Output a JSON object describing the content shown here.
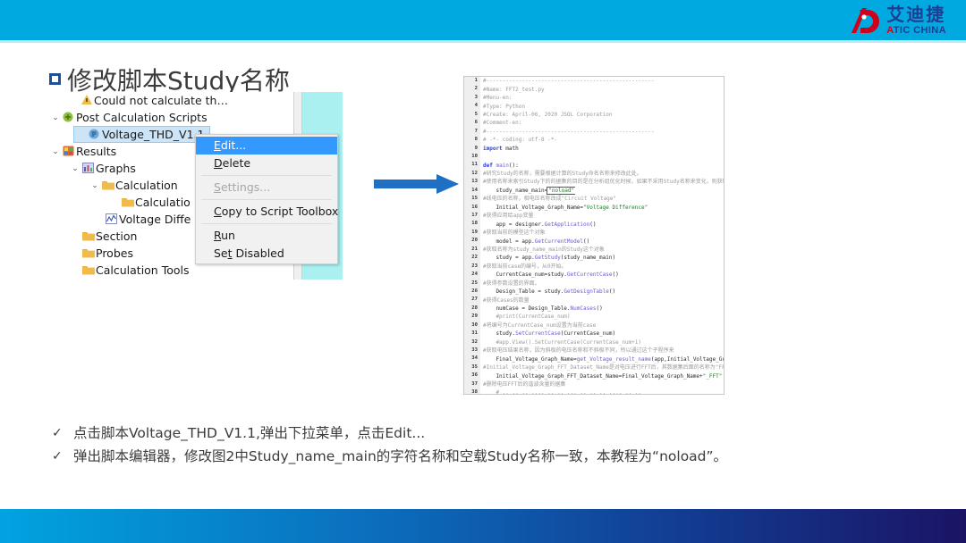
{
  "header": {
    "logo": {
      "mark": "ad-monogram-icon",
      "chinese": "艾迪捷",
      "english_a": "A",
      "english_rest": "TIC CHINA"
    },
    "bar_color": "#00a9e0"
  },
  "title": {
    "bullet": "square-bullet-icon",
    "text": "修改脚本Study名称"
  },
  "tree": {
    "rows": [
      {
        "indent": 28,
        "chevron": "",
        "icon": "warning-icon",
        "label": "Could not calculate th…",
        "selected": false
      },
      {
        "indent": 8,
        "chevron": "⌄",
        "icon": "script-folder-icon",
        "label": "Post Calculation Scripts",
        "selected": false
      },
      {
        "indent": 34,
        "chevron": "",
        "icon": "script-icon",
        "label": "Voltage_THD_V1.1",
        "selected": true
      },
      {
        "indent": 8,
        "chevron": "⌄",
        "icon": "results-icon",
        "label": "Results",
        "selected": false
      },
      {
        "indent": 30,
        "chevron": "⌄",
        "icon": "graphs-icon",
        "label": "Graphs",
        "selected": false
      },
      {
        "indent": 52,
        "chevron": "⌄",
        "icon": "folder-icon",
        "label": "Calculation",
        "selected": false
      },
      {
        "indent": 74,
        "chevron": "",
        "icon": "folder-icon",
        "label": "Calculatio",
        "selected": false
      },
      {
        "indent": 56,
        "chevron": "",
        "icon": "graph-curve-icon",
        "label": "Voltage Diffe",
        "selected": false
      },
      {
        "indent": 30,
        "chevron": "",
        "icon": "folder-icon",
        "label": "Section",
        "selected": false
      },
      {
        "indent": 30,
        "chevron": "",
        "icon": "folder-icon",
        "label": "Probes",
        "selected": false
      },
      {
        "indent": 30,
        "chevron": "",
        "icon": "folder-icon",
        "label": "Calculation Tools",
        "selected": false
      }
    ]
  },
  "context_menu": {
    "items": [
      {
        "label": "Edit...",
        "mnemonic": "E",
        "state": "selected"
      },
      {
        "label": "Delete",
        "mnemonic": "D",
        "state": "normal"
      },
      {
        "label": "Settings...",
        "mnemonic": "S",
        "state": "disabled"
      },
      {
        "label": "Copy to Script Toolbox",
        "mnemonic": "C",
        "state": "normal"
      },
      {
        "label": "Run",
        "mnemonic": "R",
        "state": "normal"
      },
      {
        "label": "Set Disabled",
        "mnemonic": "t",
        "state": "normal"
      }
    ]
  },
  "arrow": {
    "name": "right-arrow",
    "color": "#1f6fc4"
  },
  "code": {
    "highlight_value": "noload",
    "lines": [
      {
        "n": 1,
        "html": "<span class='cmt'>#----------------------------------------------------</span>"
      },
      {
        "n": 2,
        "html": "<span class='cmt'>#Name:&nbsp;FFT2_test.py</span>"
      },
      {
        "n": 3,
        "html": "<span class='cmt'>#Menu-en:&nbsp;</span>"
      },
      {
        "n": 4,
        "html": "<span class='cmt'>#Type:&nbsp;Python</span>"
      },
      {
        "n": 5,
        "html": "<span class='cmt'>#Create:&nbsp;April-06,&nbsp;2020&nbsp;JSOL&nbsp;Corporation</span>"
      },
      {
        "n": 6,
        "html": "<span class='cmt'>#Comment-en:&nbsp;</span>"
      },
      {
        "n": 7,
        "html": "<span class='cmt'>#----------------------------------------------------</span>"
      },
      {
        "n": 8,
        "html": "<span class='cmt'>#&nbsp;-*-&nbsp;coding:&nbsp;utf-8&nbsp;-*-</span>"
      },
      {
        "n": 9,
        "html": "<span class='kw'>import</span> math"
      },
      {
        "n": 10,
        "html": ""
      },
      {
        "n": 11,
        "html": "<span class='kw'>def</span> <span class='fn'>main</span>():"
      },
      {
        "n": 12,
        "html": "<span class='cmt'>#研究Study的名称，需要根据计算的Study命名名称来修改此处。</span>"
      },
      {
        "n": 13,
        "html": "<span class='cmt'>#使用名称来索引Study下的的据集的目的是在分析组优化时候，如果不采用Study名称来变化，则获取的的据集都是第一个Study里理里的的据集</span>"
      },
      {
        "n": 14,
        "html": "&nbsp;&nbsp;&nbsp;&nbsp;study_name_main=<span class='str hl-box'>\"noload\"</span>"
      },
      {
        "n": 15,
        "html": "<span class='cmt'>#线电压的名称，相电压名称改成\"Circuit&nbsp;Voltage\"</span>"
      },
      {
        "n": 16,
        "html": "&nbsp;&nbsp;&nbsp;&nbsp;Initial_Voltage_Graph_Name=<span class='str'>\"Voltage&nbsp;Difference\"</span>"
      },
      {
        "n": 17,
        "html": "<span class='cmt'>#获得应用给app变量</span>"
      },
      {
        "n": 18,
        "html": "&nbsp;&nbsp;&nbsp;&nbsp;app&nbsp;=&nbsp;designer.<span class='fn'>GetApplication</span>()"
      },
      {
        "n": 19,
        "html": "<span class='cmt'>#获取当前的模型这个对象</span>"
      },
      {
        "n": 20,
        "html": "&nbsp;&nbsp;&nbsp;&nbsp;model&nbsp;=&nbsp;app.<span class='fn'>GetCurrentModel</span>()"
      },
      {
        "n": 21,
        "html": "<span class='cmt'>#获取名称为study_name_main的Study这个对象</span>"
      },
      {
        "n": 22,
        "html": "&nbsp;&nbsp;&nbsp;&nbsp;study&nbsp;=&nbsp;app.<span class='fn'>GetStudy</span>(study_name_main)"
      },
      {
        "n": 23,
        "html": "<span class='cmt'>#获取当前case的编号，从0开始。</span>"
      },
      {
        "n": 24,
        "html": "&nbsp;&nbsp;&nbsp;&nbsp;CurrentCase_num=study.<span class='fn'>GetCurrentCase</span>()"
      },
      {
        "n": 25,
        "html": "<span class='cmt'>#获得参数设置的界面。</span>"
      },
      {
        "n": 26,
        "html": "&nbsp;&nbsp;&nbsp;&nbsp;Design_Table&nbsp;=&nbsp;study.<span class='fn'>GetDesignTable</span>()"
      },
      {
        "n": 27,
        "html": "<span class='cmt'>#获得Cases的数量</span>"
      },
      {
        "n": 28,
        "html": "&nbsp;&nbsp;&nbsp;&nbsp;numCase&nbsp;=&nbsp;Design_Table.<span class='fn'>NumCases</span>()"
      },
      {
        "n": 29,
        "html": "<span class='cmt'>&nbsp;&nbsp;&nbsp;&nbsp;#print(CurrentCase_num)</span>"
      },
      {
        "n": 30,
        "html": "<span class='cmt'>#将编号为CurrentCase_num设置为当前case</span>"
      },
      {
        "n": 31,
        "html": "&nbsp;&nbsp;&nbsp;&nbsp;study.<span class='fn'>SetCurrentCase</span>(CurrentCase_num)"
      },
      {
        "n": 32,
        "html": "<span class='cmt'>&nbsp;&nbsp;&nbsp;&nbsp;#app.View().SetCurrentCase(CurrentCase_num+1)</span>"
      },
      {
        "n": 33,
        "html": "<span class='cmt'>#获取电压结果名称，因为斜极的电压名称和不斜极不同，所以通过这个子程序来</span>"
      },
      {
        "n": 34,
        "html": "&nbsp;&nbsp;&nbsp;&nbsp;Final_Voltage_Graph_Name=<span class='fn'>get_Voltage_result_name</span>(app,Initial_Voltage_Graph_Name)"
      },
      {
        "n": 35,
        "html": "<span class='cmt'>#Initial_Voltage_Graph_FFT_Dataset_Name是对电压进行FFT后，其数据集后面的名称为\"FFT\"</span>"
      },
      {
        "n": 36,
        "html": "&nbsp;&nbsp;&nbsp;&nbsp;Initial_Voltage_Graph_FFT_Dataset_Name=Final_Voltage_Graph_Name+<span class='str'>\"_FFT\"</span>"
      },
      {
        "n": 37,
        "html": "<span class='cmt'>#删除电压FFT后的谐波含量的据集</span>"
      },
      {
        "n": 38,
        "html": "<span class='cmt'>&nbsp;&nbsp;&nbsp;&nbsp;#&nbsp;..&nbsp;..&nbsp;..&nbsp;....&nbsp;..&nbsp;..&nbsp;...&nbsp;..&nbsp;..&nbsp;..&nbsp;....&nbsp;..&nbsp;..</span>"
      }
    ]
  },
  "bullets": [
    {
      "marker": "check-icon",
      "text": "点击脚本Voltage_THD_V1.1,弹出下拉菜单，点击Edit..."
    },
    {
      "marker": "check-icon",
      "text": "弹出脚本编辑器，修改图2中Study_name_main的字符名称和空载Study名称一致，本教程为“noload”。"
    }
  ],
  "footer": {
    "gradient_from": "#00a3e0",
    "gradient_to": "#1b1464"
  }
}
